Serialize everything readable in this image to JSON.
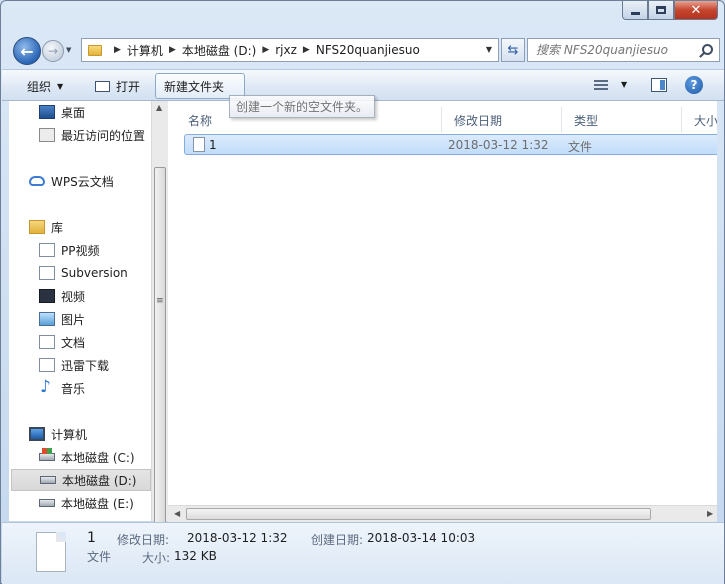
{
  "window": {
    "controls": [
      "minimize",
      "maximize",
      "close"
    ]
  },
  "nav": {
    "breadcrumb": [
      "计算机",
      "本地磁盘 (D:)",
      "rjxz",
      "NFS20quanjiesuo"
    ],
    "search_placeholder": "搜索 NFS20quanjiesuo"
  },
  "toolbar": {
    "organize": "组织",
    "open": "打开",
    "new_folder": "新建文件夹",
    "tooltip": "创建一个新的空文件夹。"
  },
  "sidebar": {
    "items": [
      {
        "label": "桌面",
        "icon": "desktop-icon"
      },
      {
        "label": "最近访问的位置",
        "icon": "recent-places-icon"
      },
      {
        "label": "WPS云文档",
        "icon": "cloud-icon"
      },
      {
        "label": "库",
        "icon": "library-icon"
      },
      {
        "label": "PP视频",
        "icon": "library-doc-icon"
      },
      {
        "label": "Subversion",
        "icon": "library-doc-icon"
      },
      {
        "label": "视频",
        "icon": "video-icon"
      },
      {
        "label": "图片",
        "icon": "picture-icon"
      },
      {
        "label": "文档",
        "icon": "document-icon"
      },
      {
        "label": "迅雷下载",
        "icon": "library-doc-icon"
      },
      {
        "label": "音乐",
        "icon": "music-icon"
      },
      {
        "label": "计算机",
        "icon": "computer-icon"
      },
      {
        "label": "本地磁盘 (C:)",
        "icon": "system-drive-icon"
      },
      {
        "label": "本地磁盘 (D:)",
        "icon": "drive-icon",
        "selected": true
      },
      {
        "label": "本地磁盘 (E:)",
        "icon": "drive-icon"
      }
    ]
  },
  "list": {
    "columns": [
      "名称",
      "修改日期",
      "类型",
      "大小"
    ],
    "rows": [
      {
        "name": "1",
        "modified": "2018-03-12 1:32",
        "type": "文件",
        "selected": true
      }
    ]
  },
  "details": {
    "name": "1",
    "type": "文件",
    "modified_label": "修改日期:",
    "modified": "2018-03-12 1:32",
    "created_label": "创建日期:",
    "created": "2018-03-14 10:03",
    "size_label": "大小:",
    "size": "132 KB"
  },
  "colors": {
    "selection": "#cde3fb",
    "frame": "#c3d7ee",
    "close_button": "#c6452f"
  }
}
